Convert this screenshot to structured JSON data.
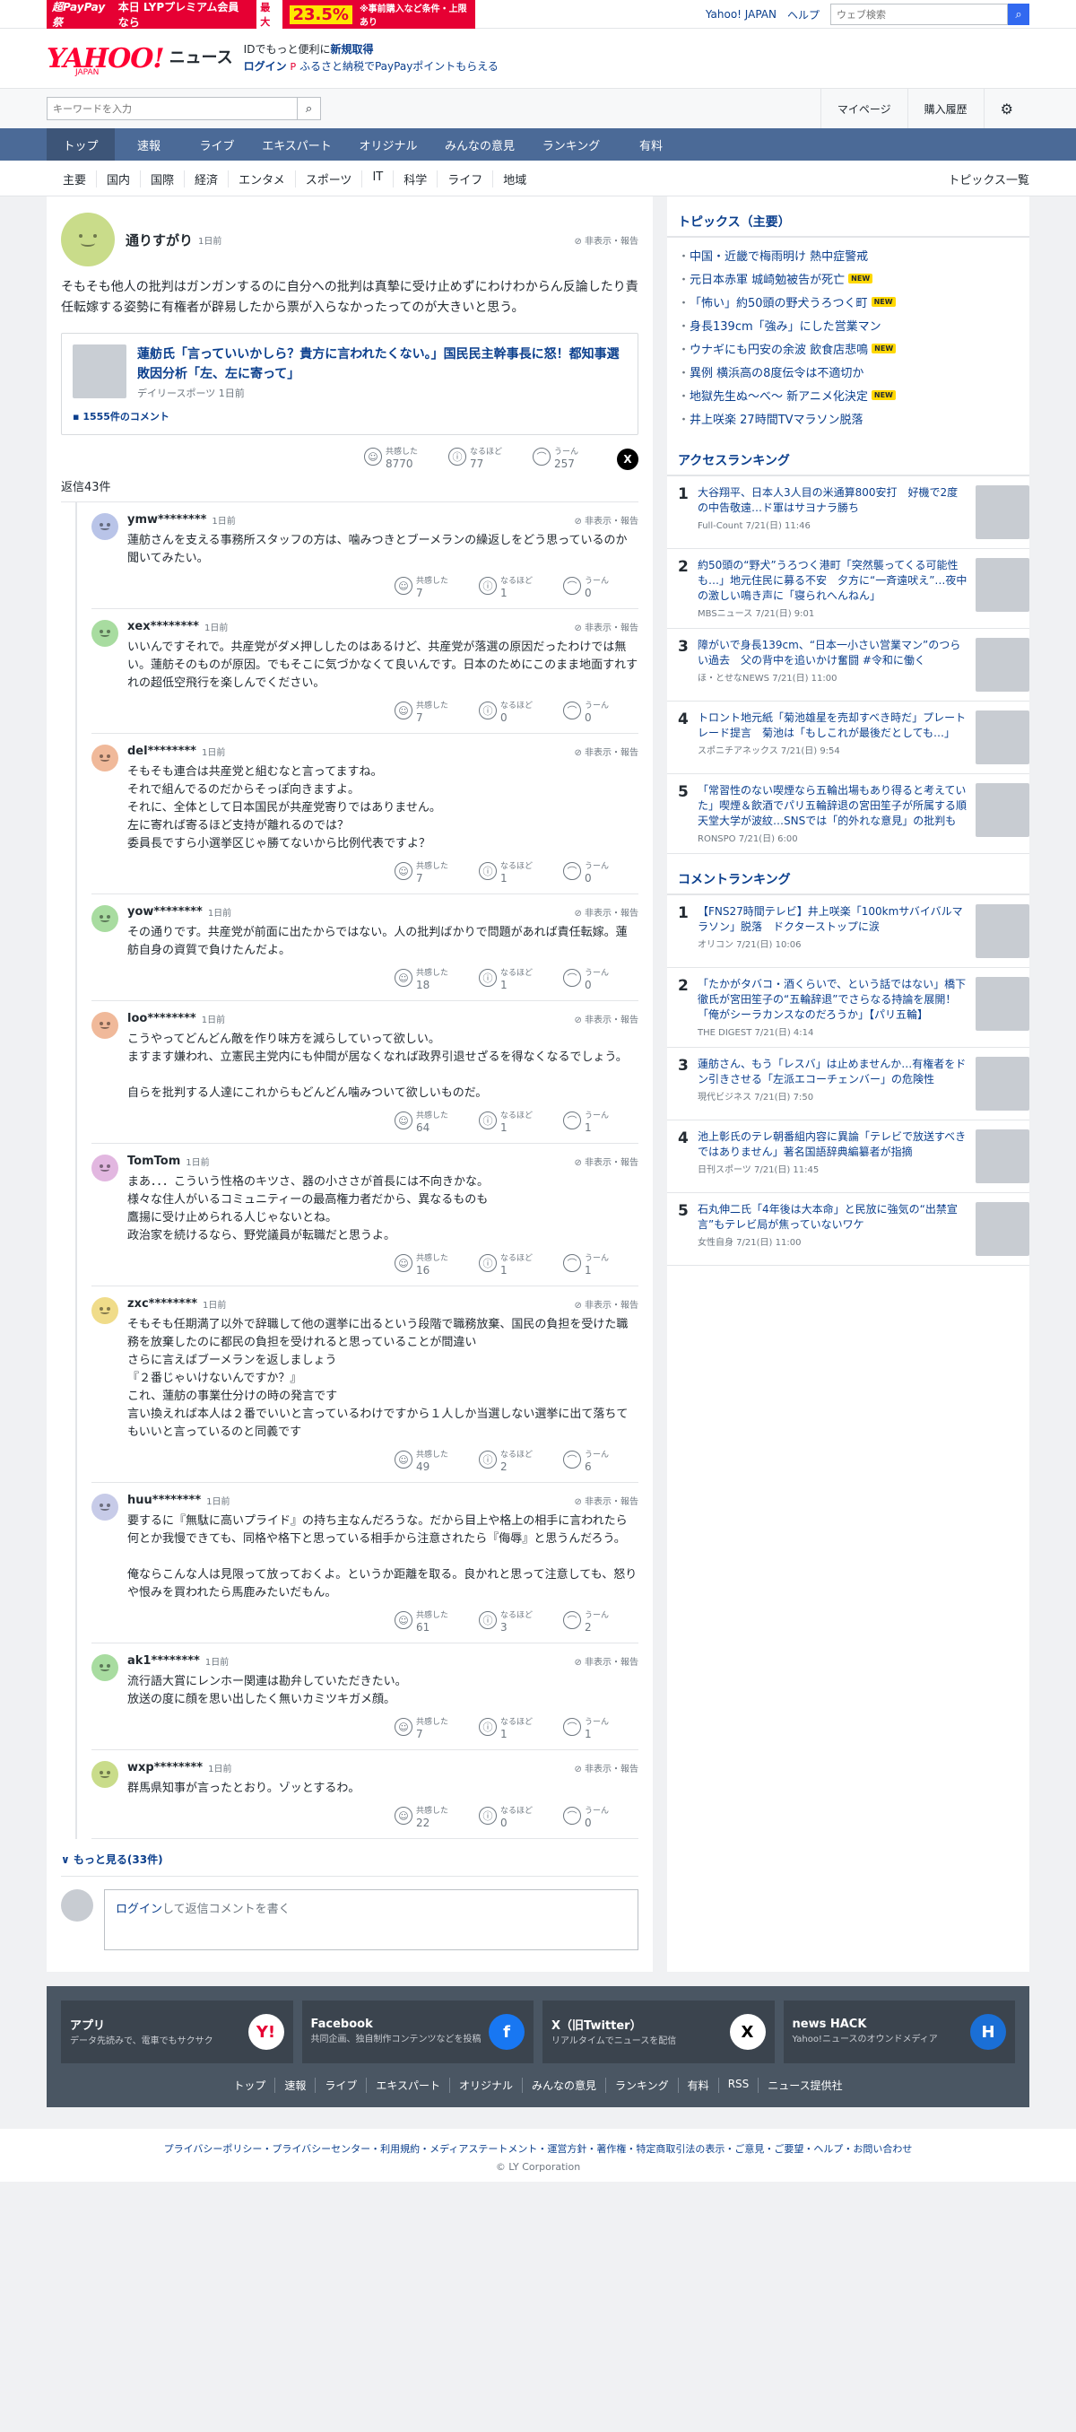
{
  "promo": {
    "brand": "超PayPay祭",
    "text": "本日 LYPプレミアム会員なら",
    "tag": "最大",
    "pct": "23.5%",
    "small": "※事前購入など条件・上限あり"
  },
  "toplinks": {
    "yahoo": "Yahoo! JAPAN",
    "help": "ヘルプ",
    "web_placeholder": "ウェブ検索"
  },
  "header": {
    "logo": "YAHOO!",
    "logo_sub": "JAPAN",
    "news": "ニュース",
    "id_text": "IDでもっと便利に",
    "signup": "新規取得",
    "login": "ログイン",
    "furusato": "ふるさと納税でPayPayポイントもらえる"
  },
  "search": {
    "placeholder": "キーワードを入力",
    "mypage": "マイページ",
    "history": "購入履歴"
  },
  "gnav": [
    "トップ",
    "速報",
    "ライブ",
    "エキスパート",
    "オリジナル",
    "みんなの意見",
    "ランキング",
    "有料"
  ],
  "subnav": [
    "主要",
    "国内",
    "国際",
    "経済",
    "エンタメ",
    "スポーツ",
    "IT",
    "科学",
    "ライフ",
    "地域"
  ],
  "subnav_more": "トピックス一覧",
  "main_comment": {
    "user": "通りすがり",
    "time": "1日前",
    "report": "非表示・報告",
    "text": "そもそも他人の批判はガンガンするのに自分への批判は真摯に受け止めずにわけわからん反論したり責任転嫁する姿勢に有権者が辟易したから票が入らなかったってのが大きいと思う。",
    "article_title": "蓮舫氏「言っていいかしら？貴方に言われたくない。」国民民主幹事長に怒！都知事選敗因分析「左、左に寄って」",
    "article_source": "デイリースポーツ",
    "article_time": "1日前",
    "article_comments": "1555件のコメント",
    "reacts": {
      "a": "共感した",
      "an": "8770",
      "b": "なるほど",
      "bn": "77",
      "c": "うーん",
      "cn": "257"
    },
    "replies_count": "返信43件"
  },
  "replies": [
    {
      "user": "ymw********",
      "time": "1日前",
      "text": "蓮舫さんを支える事務所スタッフの方は、噛みつきとブーメランの繰返しをどう思っているのか聞いてみたい。",
      "a": "7",
      "b": "1",
      "c": "0",
      "color": "#b9c4e8"
    },
    {
      "user": "xex********",
      "time": "1日前",
      "text": "いいんですそれで。共産党がダメ押ししたのはあるけど、共産党が落選の原因だったわけでは無い。蓮舫そのものが原因。でもそこに気づかなくて良いんです。日本のためにこのまま地面すれすれの超低空飛行を楽しんでください。",
      "a": "7",
      "b": "0",
      "c": "0",
      "color": "#a8dca0"
    },
    {
      "user": "del********",
      "time": "1日前",
      "text": "そもそも連合は共産党と組むなと言ってますね。\nそれで組んでるのだからそっぽ向きますよ。\nそれに、全体として日本国民が共産党寄りではありません。\n左に寄れば寄るほど支持が離れるのでは？\n委員長ですら小選挙区じゃ勝てないから比例代表ですよ？",
      "a": "7",
      "b": "1",
      "c": "0",
      "color": "#f0b99a"
    },
    {
      "user": "yow********",
      "time": "1日前",
      "text": "その通りです。共産党が前面に出たからではない。人の批判ばかりで問題があれば責任転嫁。蓮舫自身の資質で負けたんだよ。",
      "a": "18",
      "b": "1",
      "c": "0",
      "color": "#a8dca0"
    },
    {
      "user": "loo********",
      "time": "1日前",
      "text": "こうやってどんどん敵を作り味方を減らしていって欲しい。\nますます嫌われ、立憲民主党内にも仲間が居なくなれば政界引退せざるを得なくなるでしょう。\n\n自らを批判する人達にこれからもどんどん噛みついて欲しいものだ。",
      "a": "64",
      "b": "1",
      "c": "1",
      "color": "#f0b99a"
    },
    {
      "user": "TomTom",
      "time": "1日前",
      "text": "まあ．．．こういう性格のキツさ、器の小ささが首長には不向きかな。\n様々な住人がいるコミュニティーの最高権力者だから、異なるものも\n鷹揚に受け止められる人じゃないとね。\n政治家を続けるなら、野党議員が転職だと思うよ。",
      "a": "16",
      "b": "1",
      "c": "1",
      "color": "#e2b7e0"
    },
    {
      "user": "zxc********",
      "time": "1日前",
      "text": "そもそも任期満了以外で辞職して他の選挙に出るという段階で職務放棄、国民の負担を受けた職務を放棄したのに都民の負担を受けれると思っていることが間違い\nさらに言えばブーメランを返しましょう\n『２番じゃいけないんですか？』\nこれ、蓮舫の事業仕分けの時の発言です\n言い換えれば本人は２番でいいと言っているわけですから１人しか当選しない選挙に出て落ちてもいいと言っているのと同義です",
      "a": "49",
      "b": "2",
      "c": "6",
      "color": "#f0dc8a"
    },
    {
      "user": "huu********",
      "time": "1日前",
      "text": "要するに『無駄に高いプライド』の持ち主なんだろうな。だから目上や格上の相手に言われたら何とか我慢できても、同格や格下と思っている相手から注意されたら『侮辱』と思うんだろう。\n\n俺ならこんな人は見限って放っておくよ。というか距離を取る。良かれと思って注意しても、怒りや恨みを買われたら馬鹿みたいだもん。",
      "a": "61",
      "b": "3",
      "c": "2",
      "color": "#c7cbe8"
    },
    {
      "user": "ak1********",
      "time": "1日前",
      "text": "流行語大賞にレンホー関連は勘弁していただきたい。\n放送の度に顔を思い出したく無いカミツキガメ顔。",
      "a": "7",
      "b": "1",
      "c": "1",
      "color": "#a8dca0"
    },
    {
      "user": "wxp********",
      "time": "1日前",
      "text": "群馬県知事が言ったとおり。ゾッとするわ。",
      "a": "22",
      "b": "0",
      "c": "0",
      "color": "#c9dc8a"
    }
  ],
  "more": "もっと見る(33件)",
  "reply_box": {
    "login": "ログイン",
    "text": "して返信コメントを書く"
  },
  "side": {
    "topics_title": "トピックス（主要）",
    "topics": [
      {
        "t": "中国・近畿で梅雨明け 熱中症警戒",
        "new": false
      },
      {
        "t": "元日本赤軍 城崎勉被告が死亡",
        "new": true
      },
      {
        "t": "「怖い」約50頭の野犬うろつく町",
        "new": true
      },
      {
        "t": "身長139cm「強み」にした営業マン",
        "new": false
      },
      {
        "t": "ウナギにも円安の余波 飲食店悲鳴",
        "new": true
      },
      {
        "t": "異例 横浜高の8度伝令は不適切か",
        "new": false
      },
      {
        "t": "地獄先生ぬ～べ～ 新アニメ化決定",
        "new": true
      },
      {
        "t": "井上咲楽 27時間TVマラソン脱落",
        "new": false
      }
    ],
    "access_title": "アクセスランキング",
    "access": [
      {
        "n": "1",
        "t": "大谷翔平、日本人3人目の米通算800安打　好機で2度の中告敬遠…ド軍はサヨナラ勝ち",
        "s": "Full-Count 7/21(日) 11:46"
      },
      {
        "n": "2",
        "t": "約50頭の“野犬”うろつく港町「突然襲ってくる可能性も…」地元住民に募る不安　夕方に“一斉遠吠え”…夜中の激しい鳴き声に「寝られへんねん」",
        "s": "MBSニュース 7/21(日) 9:01"
      },
      {
        "n": "3",
        "t": "障がいで身長139cm、“日本一小さい営業マン”のつらい過去　父の背中を追いかけ奮闘 #令和に働く",
        "s": "ほ・とせなNEWS 7/21(日) 11:00"
      },
      {
        "n": "4",
        "t": "トロント地元紙「菊池雄星を売却すべき時だ」プレートレード提言　菊池は「もしこれが最後だとしても…」",
        "s": "スポニチアネックス 7/21(日) 9:54"
      },
      {
        "n": "5",
        "t": "「常習性のない喫煙なら五輪出場もあり得ると考えていた」喫煙＆飲酒でパリ五輪辞退の宮田笙子が所属する順天堂大学が波紋…SNSでは「的外れな意見」の批判も",
        "s": "RONSPO 7/21(日) 6:00"
      }
    ],
    "comment_title": "コメントランキング",
    "comment": [
      {
        "n": "1",
        "t": "【FNS27時間テレビ】井上咲楽「100kmサバイバルマラソン」脱落　ドクターストップに涙",
        "s": "オリコン 7/21(日) 10:06"
      },
      {
        "n": "2",
        "t": "「たかがタバコ・酒くらいで、という話ではない」橋下徹氏が宮田笙子の“五輪辞退”でさらなる持論を展開！「俺がシーラカンスなのだろうか」【パリ五輪】",
        "s": "THE DIGEST 7/21(日) 4:14"
      },
      {
        "n": "3",
        "t": "蓮舫さん、もう「レスバ」は止めませんか…有権者をドン引きさせる「左派エコーチェンバー」の危険性",
        "s": "現代ビジネス 7/21(日) 7:50"
      },
      {
        "n": "4",
        "t": "池上彰氏のテレ朝番組内容に異論「テレビで放送すべきではありません」著名国語辞典編纂者が指摘",
        "s": "日刊スポーツ 7/21(日) 11:45"
      },
      {
        "n": "5",
        "t": "石丸伸二氏「4年後は大本命」と民放に強気の“出禁宣言”もテレビ局が焦っていないワケ",
        "s": "女性自身 7/21(日) 11:00"
      }
    ]
  },
  "footer": {
    "cards": [
      {
        "t": "アプリ",
        "d": "データ先読みで、電車でもサクサク",
        "icon": "Y!"
      },
      {
        "t": "Facebook",
        "d": "共同企画、独自制作コンテンツなどを投稿",
        "icon": "f"
      },
      {
        "t": "X（旧Twitter）",
        "d": "リアルタイムでニュースを配信",
        "icon": "X"
      },
      {
        "t": "news HACK",
        "d": "Yahoo!ニュースのオウンドメディア",
        "icon": "H"
      }
    ],
    "links": [
      "トップ",
      "速報",
      "ライブ",
      "エキスパート",
      "オリジナル",
      "みんなの意見",
      "ランキング",
      "有料",
      "RSS",
      "ニュース提供社"
    ],
    "legal": "プライバシーポリシー・プライバシーセンター・利用規約・メディアステートメント・運営方針・著作権・特定商取引法の表示・ご意見・ご要望・ヘルプ・お問い合わせ",
    "copyright": "© LY Corporation"
  }
}
